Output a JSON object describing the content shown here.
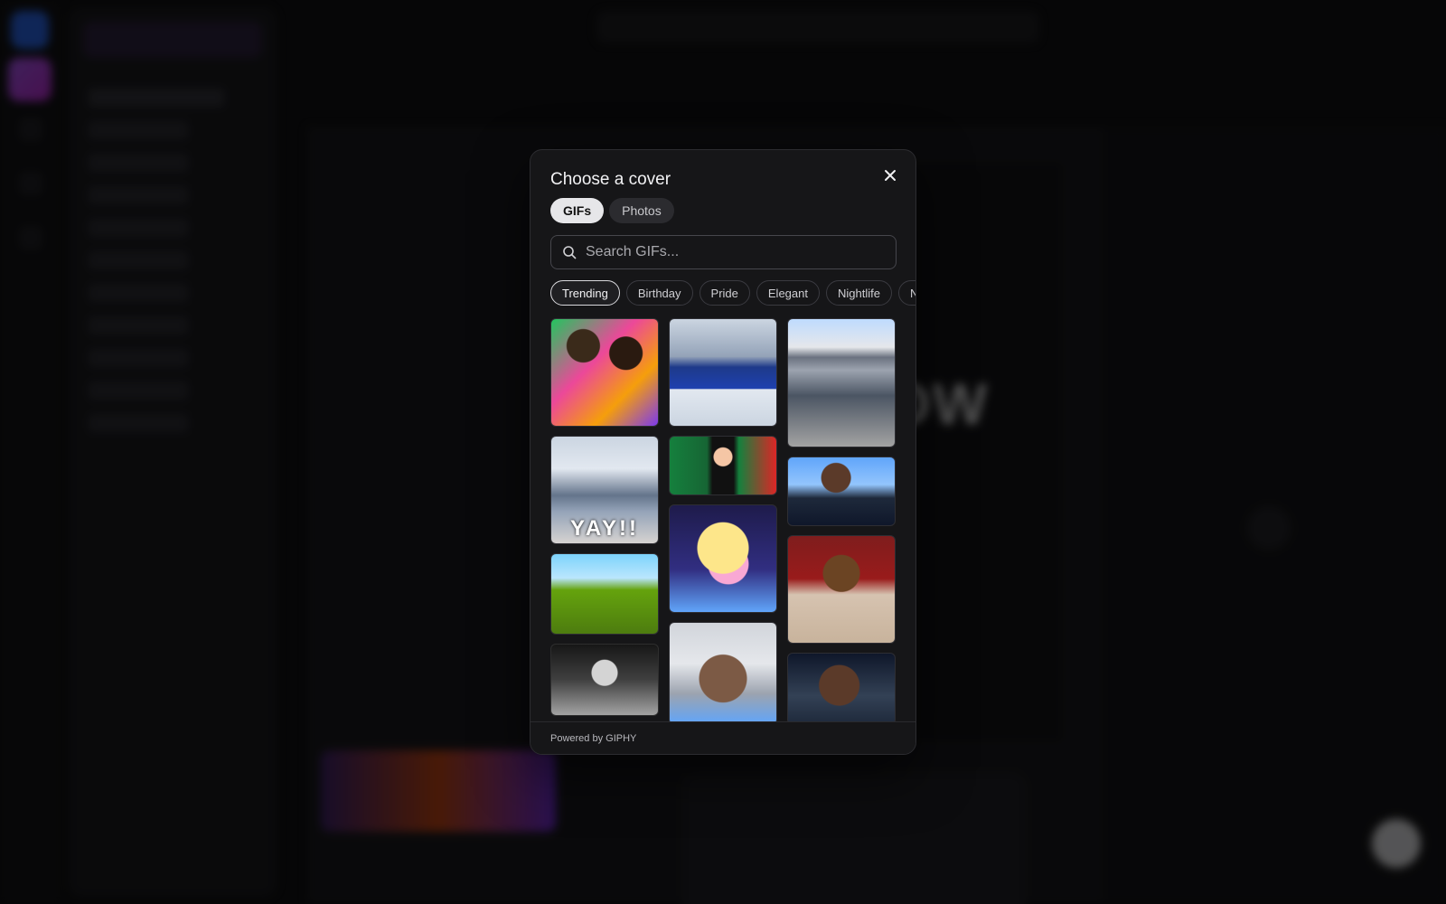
{
  "modal": {
    "title": "Choose a cover",
    "tabs": [
      {
        "label": "GIFs",
        "active": true
      },
      {
        "label": "Photos",
        "active": false
      }
    ],
    "search": {
      "placeholder": "Search GIFs...",
      "value": ""
    },
    "categories": [
      {
        "label": "Trending",
        "active": true
      },
      {
        "label": "Birthday"
      },
      {
        "label": "Pride"
      },
      {
        "label": "Elegant"
      },
      {
        "label": "Nightlife"
      },
      {
        "label": "N"
      }
    ],
    "gifs": [
      {
        "overlay_text": ""
      },
      {
        "overlay_text": ""
      },
      {
        "overlay_text": ""
      },
      {
        "overlay_text": "YAY!!"
      },
      {
        "overlay_text": ""
      },
      {
        "overlay_text": ""
      },
      {
        "overlay_text": ""
      },
      {
        "overlay_text": ""
      },
      {
        "overlay_text": ""
      },
      {
        "overlay_text": ""
      },
      {
        "overlay_text": ""
      },
      {
        "overlay_text": ""
      }
    ],
    "footer": "Powered by GIPHY"
  },
  "background": {
    "hero_text": "OW"
  },
  "colors": {
    "modal_bg": "#161618",
    "accent_chip": "#e6e6e9",
    "page_bg": "#0a0a0b"
  },
  "icons": {
    "close": "close-icon",
    "search": "search-icon"
  }
}
